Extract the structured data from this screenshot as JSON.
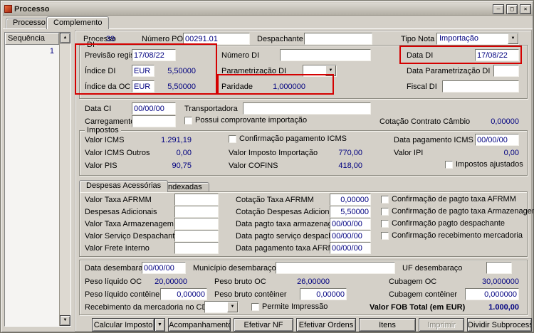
{
  "window": {
    "title": "Processo",
    "controls": {
      "minimize": "–",
      "maximize": "□",
      "close": "×"
    }
  },
  "icons": {
    "dropdown": "▼",
    "scroll_up": "▲",
    "scroll_down": "▼"
  },
  "main_tabs": {
    "processo": "Processo",
    "complemento": "Complemento"
  },
  "sequencia": {
    "header": "Sequência",
    "rows": [
      "1"
    ]
  },
  "top": {
    "processo": {
      "label": "Processo",
      "value": "39"
    },
    "numero_po": {
      "label": "Número PO",
      "value": "00291.01"
    },
    "despachante": {
      "label": "Despachante",
      "value": ""
    },
    "tipo_nota": {
      "label": "Tipo Nota",
      "value": "Importação"
    }
  },
  "di": {
    "legend": "DI",
    "previsao_registro": {
      "label": "Previsão registro",
      "value": "17/08/22"
    },
    "numero_di": {
      "label": "Número DI",
      "value": ""
    },
    "data_di": {
      "label": "Data DI",
      "value": "17/08/22"
    },
    "indice_di": {
      "label": "Índice DI",
      "currency": "EUR",
      "value": "5,50000"
    },
    "parametrizacao_di": {
      "label": "Parametrização DI",
      "value": ""
    },
    "data_parametrizacao_di": {
      "label": "Data Parametrização DI",
      "value": ""
    },
    "indice_oc": {
      "label": "Índice da OC",
      "currency": "EUR",
      "value": "5,50000"
    },
    "paridade": {
      "label": "Paridade",
      "value": "1,000000"
    },
    "fiscal_di": {
      "label": "Fiscal DI",
      "value": ""
    }
  },
  "ci": {
    "data_ci": {
      "label": "Data CI",
      "value": "00/00/00"
    },
    "transportadora": {
      "label": "Transportadora",
      "value": ""
    },
    "carregamento": {
      "label": "Carregamento",
      "value": ""
    },
    "possui_comprovante": {
      "label": "Possui comprovante importação",
      "checked": false
    },
    "cotacao_contrato_cambio": {
      "label": "Cotação Contrato Câmbio",
      "value": "0,00000"
    }
  },
  "impostos": {
    "legend": "Impostos",
    "valor_icms": {
      "label": "Valor ICMS",
      "value": "1.291,19"
    },
    "confirmacao_pagamento_icms": {
      "label": "Confirmação pagamento ICMS",
      "checked": false
    },
    "data_pagamento_icms": {
      "label": "Data pagamento ICMS",
      "value": "00/00/00"
    },
    "valor_icms_outros": {
      "label": "Valor ICMS Outros",
      "value": "0,00"
    },
    "valor_imposto_importacao": {
      "label": "Valor Imposto Importação",
      "value": "770,00"
    },
    "valor_ipi": {
      "label": "Valor IPI",
      "value": "0,00"
    },
    "valor_pis": {
      "label": "Valor PIS",
      "value": "90,75"
    },
    "valor_cofins": {
      "label": "Valor COFINS",
      "value": "418,00"
    },
    "impostos_ajustados": {
      "label": "Impostos ajustados",
      "checked": false
    }
  },
  "despesas": {
    "tabs": [
      "Despesas Acessórias",
      "Indexadas"
    ],
    "valor_taxa_afrmm": {
      "label": "Valor Taxa AFRMM",
      "value": ""
    },
    "cotacao_taxa_afrmm": {
      "label": "Cotação Taxa AFRMM",
      "value": "0,00000"
    },
    "conf_pagto_taxa_afrmm": {
      "label": "Confirmação de pagto taxa AFRMM",
      "checked": false
    },
    "despesas_adicionais": {
      "label": "Despesas Adicionais",
      "value": ""
    },
    "cotacao_despesas_adicionais": {
      "label": "Cotação Despesas Adicionais",
      "value": "5,50000"
    },
    "conf_pagto_taxa_armazenagem": {
      "label": "Confirmação de pagto taxa Armazenagem",
      "checked": false
    },
    "valor_taxa_armazenagem": {
      "label": "Valor Taxa Armazenagem",
      "value": ""
    },
    "data_pagto_taxa_armazenagem": {
      "label": "Data pagto taxa armazenagem",
      "value": "00/00/00"
    },
    "conf_pagto_despachante": {
      "label": "Confirmação pagto despachante",
      "checked": false
    },
    "valor_servico_despachante": {
      "label": "Valor Serviço Despachante",
      "value": ""
    },
    "data_pagto_servico_despachante": {
      "label": "Data pagto serviço despachante",
      "value": "00/00/00"
    },
    "conf_recebimento_mercadoria": {
      "label": "Confirmação recebimento mercadoria",
      "checked": false
    },
    "valor_frete_interno": {
      "label": "Valor Frete Interno",
      "value": ""
    },
    "data_pagamento_taxa_afrmm": {
      "label": "Data pagamento taxa AFRMM",
      "value": "00/00/00"
    }
  },
  "desembaraco": {
    "data": {
      "label": "Data desembaraço",
      "value": "00/00/00"
    },
    "municipio": {
      "label": "Município desembaraço",
      "value": ""
    },
    "uf": {
      "label": "UF desembaraço",
      "value": ""
    }
  },
  "pesos": {
    "peso_liquido_oc": {
      "label": "Peso líquido OC",
      "value": "20,00000"
    },
    "peso_bruto_oc": {
      "label": "Peso bruto OC",
      "value": "26,00000"
    },
    "cubagem_oc": {
      "label": "Cubagem OC",
      "value": "30,000000"
    },
    "peso_liquido_conteiner": {
      "label": "Peso líquido contêiner",
      "value": "0,00000"
    },
    "peso_bruto_conteiner": {
      "label": "Peso bruto contêiner",
      "value": "0,00000"
    },
    "cubagem_conteiner": {
      "label": "Cubagem contêiner",
      "value": "0,000000"
    }
  },
  "recebimento": {
    "label": "Recebimento da mercadoria no CD",
    "value": "",
    "permite_impressao": {
      "label": "Permite Impressão",
      "checked": false
    },
    "valor_fob": {
      "label": "Valor FOB Total (em EUR)",
      "value": "1.000,00"
    }
  },
  "buttons": {
    "calcular_imposto": "Calcular Imposto",
    "acompanhamento": "Acompanhamento",
    "efetivar_nf": "Efetivar NF",
    "efetivar_ordens": "Efetivar Ordens",
    "itens": "Itens",
    "imprimir": "Imprimir",
    "dividir_subprocesso": "Dividir Subprocesso"
  },
  "colors": {
    "value_text": "#000080",
    "annotation": "#d40000",
    "window_bg": "#d4d0c8"
  }
}
